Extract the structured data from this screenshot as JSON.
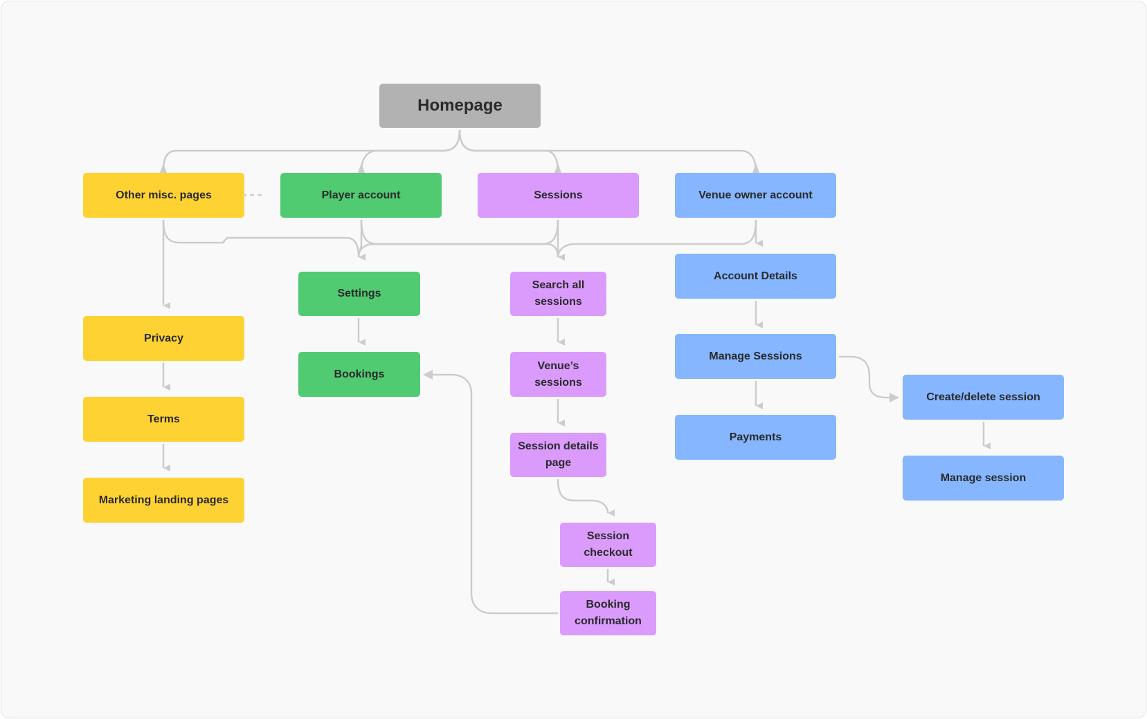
{
  "diagram": {
    "type": "sitemap",
    "colors": {
      "root": "#b2b2b2",
      "misc": "#ffd233",
      "player": "#50cb72",
      "sessions": "#da9bfd",
      "venue": "#85b6ff",
      "connector": "#cccccc",
      "text": "#2a2a2a",
      "background": "#f9f9f9"
    },
    "nodes": {
      "homepage": "Homepage",
      "other_misc": "Other misc. pages",
      "player_account": "Player account",
      "sessions": "Sessions",
      "venue_owner": "Venue owner account",
      "settings": "Settings",
      "bookings": "Bookings",
      "search_all": "Search all sessions",
      "venues_sessions": "Venue’s sessions",
      "session_details": "Session details page",
      "session_checkout": "Session checkout",
      "booking_confirmation": "Booking confirmation",
      "account_details": "Account Details",
      "manage_sessions": "Manage Sessions",
      "payments": "Payments",
      "create_delete": "Create/delete session",
      "manage_session": "Manage session",
      "privacy": "Privacy",
      "terms": "Terms",
      "marketing": "Marketing landing pages"
    },
    "edges": [
      {
        "from": "Homepage",
        "to": "Other misc. pages"
      },
      {
        "from": "Homepage",
        "to": "Player account"
      },
      {
        "from": "Homepage",
        "to": "Sessions"
      },
      {
        "from": "Homepage",
        "to": "Venue owner account"
      },
      {
        "from": "Other misc. pages",
        "to": "Player account",
        "style": "dashed"
      },
      {
        "from": "Other misc. pages",
        "to": "Privacy"
      },
      {
        "from": "Other misc. pages",
        "to": "Settings"
      },
      {
        "from": "Player account",
        "to": "Settings"
      },
      {
        "from": "Player account",
        "to": "Search all sessions"
      },
      {
        "from": "Sessions",
        "to": "Settings"
      },
      {
        "from": "Sessions",
        "to": "Search all sessions"
      },
      {
        "from": "Venue owner account",
        "to": "Search all sessions"
      },
      {
        "from": "Venue owner account",
        "to": "Account Details"
      },
      {
        "from": "Settings",
        "to": "Bookings"
      },
      {
        "from": "Privacy",
        "to": "Terms"
      },
      {
        "from": "Terms",
        "to": "Marketing landing pages"
      },
      {
        "from": "Search all sessions",
        "to": "Venue’s sessions"
      },
      {
        "from": "Venue’s sessions",
        "to": "Session details page"
      },
      {
        "from": "Session details page",
        "to": "Session checkout"
      },
      {
        "from": "Session checkout",
        "to": "Booking confirmation"
      },
      {
        "from": "Booking confirmation",
        "to": "Bookings"
      },
      {
        "from": "Account Details",
        "to": "Manage Sessions"
      },
      {
        "from": "Manage Sessions",
        "to": "Payments"
      },
      {
        "from": "Manage Sessions",
        "to": "Create/delete session"
      },
      {
        "from": "Create/delete session",
        "to": "Manage session"
      }
    ]
  }
}
